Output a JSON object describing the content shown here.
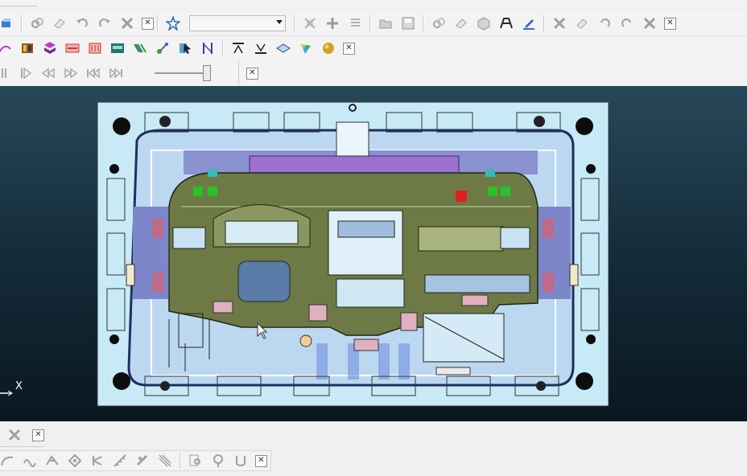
{
  "toolbars": {
    "row1": {
      "icons": [
        "select-icon",
        "link-icon",
        "eraser-icon",
        "undo-icon",
        "redo-icon",
        "tools-cross-icon"
      ],
      "icons2": [
        "star-snap-icon"
      ],
      "combo_value": "",
      "icons3": [
        "transform-icon",
        "move-icon",
        "list-icon"
      ],
      "icons4": [
        "open-file-icon",
        "save-file-icon"
      ],
      "icons5": [
        "link2-icon",
        "eraser2-icon",
        "cube-icon",
        "table-icon",
        "pen-icon"
      ],
      "icons6": [
        "tools-cross2-icon",
        "eraser3-icon",
        "undo2-icon",
        "redo2-icon",
        "tools-cross3-icon"
      ]
    },
    "row2": {
      "icons": [
        "curve-icon",
        "box-color-icon",
        "stack-color-icon",
        "plate-red-icon",
        "block-red-icon",
        "block-green-icon",
        "pattern-icon",
        "pick-icon",
        "cursor-icon",
        "split-icon",
        "align-top-icon",
        "align-bottom-icon",
        "diamond-icon",
        "paint-icon",
        "sphere-icon"
      ]
    },
    "row3": {
      "icons": [
        "stop-icon",
        "play-icon",
        "rewind-icon",
        "fast-forward-icon",
        "skip-back-icon",
        "skip-forward-icon"
      ],
      "slider_level": 1
    }
  },
  "viewport": {
    "axis_label": "X"
  },
  "bottom_toolbars": {
    "row1": {
      "icons": [
        "tools-cross4-icon"
      ]
    },
    "row2": {
      "icons": [
        "edge-curve-icon",
        "wave-icon",
        "grid-icon",
        "node-icon",
        "fork-icon",
        "measure-icon",
        "slash-icon",
        "zoom-doc-icon",
        "pin-icon",
        "tube-icon"
      ]
    }
  }
}
